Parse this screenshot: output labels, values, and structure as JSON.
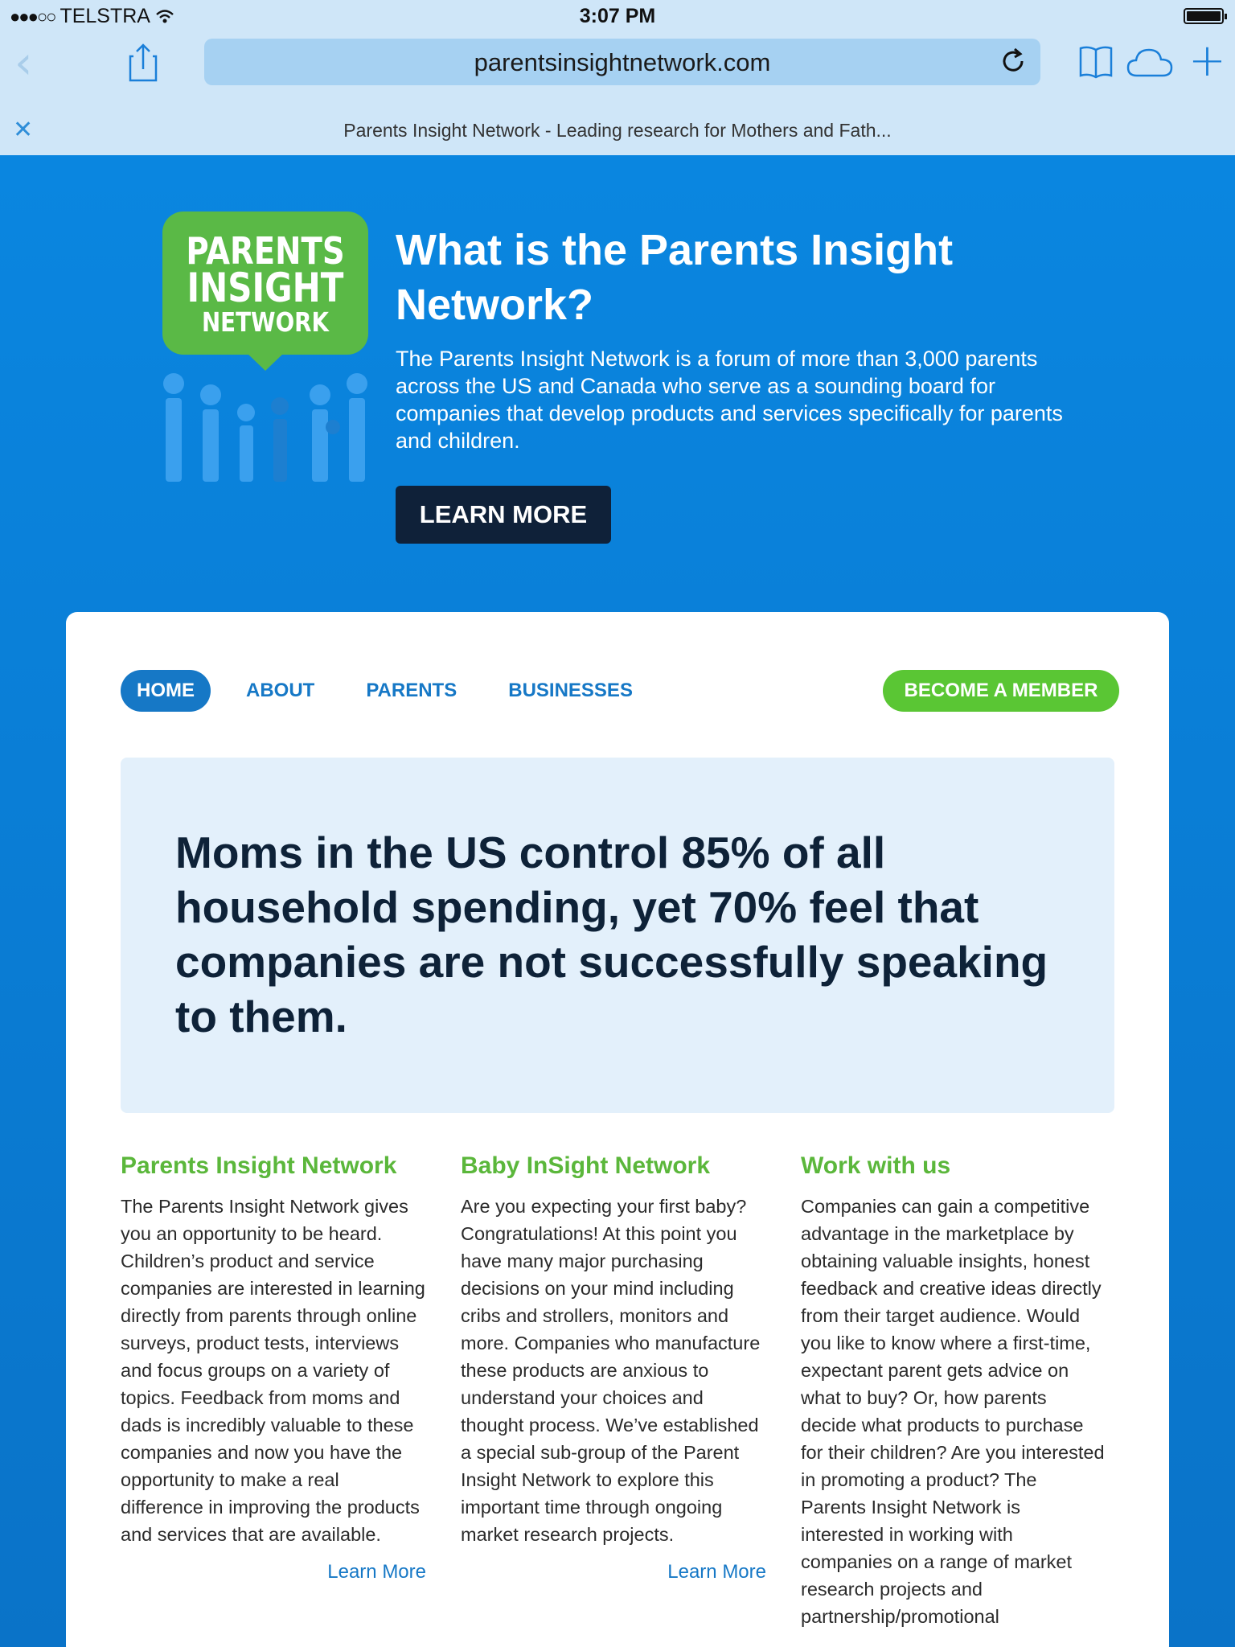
{
  "status": {
    "carrier": "TELSTRA",
    "signal_dots": "●●●○○",
    "time": "3:07 PM"
  },
  "browser": {
    "url": "parentsinsightnetwork.com",
    "tab_title": "Parents Insight Network - Leading research for Mothers and Fath...",
    "back_icon": "chevron-left-icon",
    "share_icon": "share-icon",
    "reload_icon": "reload-icon",
    "bookmarks_icon": "bookmarks-icon",
    "cloud_icon": "icloud-tabs-icon",
    "plus_icon": "new-tab-icon",
    "tint": "#cfe6f8",
    "accent": "#1a7fd9"
  },
  "hero": {
    "logo_lines": [
      "PARENTS",
      "INSIGHT",
      "NETWORK"
    ],
    "title": "What is the Parents Insight Network?",
    "text": "The Parents Insight Network is a forum of more than 3,000 parents across the US and Canada who serve as a sounding board for companies that develop products and services specifically for parents and children.",
    "button": "LEARN MORE"
  },
  "nav": {
    "items": [
      {
        "label": "HOME",
        "active": true
      },
      {
        "label": "ABOUT",
        "active": false
      },
      {
        "label": "PARENTS",
        "active": false
      },
      {
        "label": "BUSINESSES",
        "active": false
      }
    ],
    "member_button": "BECOME A MEMBER"
  },
  "quote": "Moms in the US control 85% of all household spending, yet 70% feel that companies are not successfully speaking to them.",
  "columns": [
    {
      "title": "Parents Insight Network",
      "text": "The Parents Insight Network gives you an opportunity to be heard. Children’s product and service companies are interested in learning directly from parents through online surveys, product tests, interviews and focus groups on a variety of topics. Feedback from moms and dads is incredibly valuable to these companies and now you have the opportunity to make a real difference in improving the products and services that are available.",
      "link": "Learn More"
    },
    {
      "title": "Baby InSight Network",
      "text": "Are you expecting your first baby? Congratulations! At this point you have many major purchasing decisions on your mind including cribs and strollers, monitors and more. Companies who manufacture these products are anxious to understand your choices and thought process. We’ve established a special sub-group of the Parent Insight Network to explore this important time through ongoing market research projects.",
      "link": "Learn More"
    },
    {
      "title": "Work with us",
      "text": "Companies can gain a competitive advantage in the marketplace by obtaining valuable insights, honest feedback and creative ideas directly from their target audience. Would you like to know where a first-time, expectant parent gets advice on what to buy? Or, how parents decide what products to purchase for their children? Are you interested in promoting a product? The Parents Insight Network is interested in working with companies on a range of market research projects and partnership/promotional"
    }
  ],
  "colors": {
    "page_blue": "#0a86e0",
    "logo_green": "#5ab946",
    "nav_blue": "#1678c6",
    "member_green": "#5ac634",
    "dark_navy": "#0f2139"
  }
}
